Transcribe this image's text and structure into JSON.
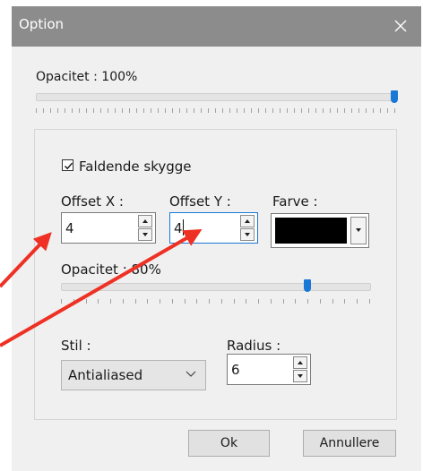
{
  "window": {
    "title": "Option"
  },
  "main_opacity": {
    "label": "Opacitet : 100%",
    "value_percent": 100
  },
  "shadow_group": {
    "checkbox_label": "Faldende skygge",
    "checked": true,
    "offset_x": {
      "label": "Offset X :",
      "value": "4"
    },
    "offset_y": {
      "label": "Offset Y :",
      "value": "4"
    },
    "color": {
      "label": "Farve :",
      "value": "#000000"
    },
    "opacity": {
      "label": "Opacitet : 80%",
      "value_percent": 80
    },
    "style": {
      "label": "Stil :",
      "value": "Antialiased"
    },
    "radius": {
      "label": "Radius :",
      "value": "6"
    }
  },
  "buttons": {
    "ok": "Ok",
    "cancel": "Annullere"
  },
  "annotations": {
    "arrow_color": "#ee3124",
    "arrow_count": 2
  },
  "icons": {
    "close": "close-icon",
    "checkmark": "checkmark-icon",
    "spin_up": "triangle-up-icon",
    "spin_down": "triangle-down-icon",
    "dropdown": "chevron-down-icon"
  }
}
